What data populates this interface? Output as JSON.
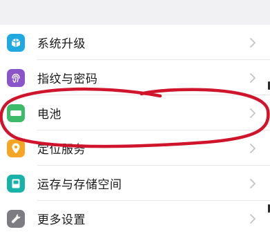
{
  "settings": {
    "items": [
      {
        "label": "系统升级",
        "icon": "system-update-icon",
        "color": "#20a8e0"
      },
      {
        "label": "指纹与密码",
        "icon": "fingerprint-icon",
        "color": "#8a55c8"
      },
      {
        "label": "电池",
        "icon": "battery-icon",
        "color": "#3dba6a"
      },
      {
        "label": "定位服务",
        "icon": "location-icon",
        "color": "#f5a524"
      },
      {
        "label": "运存与存储空间",
        "icon": "storage-icon",
        "color": "#19b2a8"
      },
      {
        "label": "更多设置",
        "icon": "wrench-icon",
        "color": "#7c7c82"
      }
    ]
  },
  "colors": {
    "background": "#f1f1f3",
    "row_background": "#ffffff",
    "annotation_stroke": "#d0142b",
    "chevron": "#c4c4c8"
  }
}
